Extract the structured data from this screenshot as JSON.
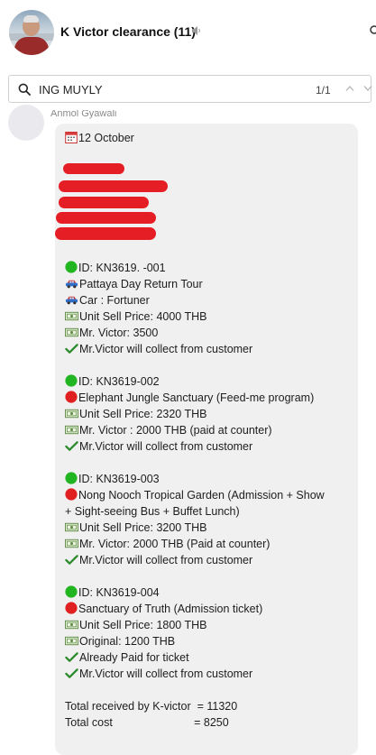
{
  "header": {
    "chat_title": "K Victor clearance (11)"
  },
  "search": {
    "query": "ING MUYLY",
    "match_count": "1/1"
  },
  "message": {
    "sender_name": "Anmol Gyawali",
    "date_line": "12 October",
    "bookings": [
      {
        "id_line": "ID: KN3619. -001",
        "tour_line": "Pattaya Day Return Tour",
        "car_line": "Car : Fortuner",
        "sell_price_line": "Unit Sell Price: 4000 THB",
        "cost_line": "Mr. Victor: 3500",
        "collect_line": "Mr.Victor will collect from customer"
      },
      {
        "id_line": "ID: KN3619-002",
        "tour_line": "Elephant Jungle Sanctuary (Feed-me program)",
        "sell_price_line": "Unit Sell Price: 2320 THB",
        "cost_line": "Mr. Victor : 2000 THB (paid at counter)",
        "collect_line": "Mr.Victor will collect from customer"
      },
      {
        "id_line": "ID: KN3619-003",
        "tour_line_1": "Nong Nooch Tropical Garden (Admission + Show",
        "tour_line_2": "+ Sight-seeing Bus + Buffet Lunch)",
        "sell_price_line": "Unit Sell Price: 3200 THB",
        "cost_line": "Mr. Victor: 2000 THB (Paid at counter)",
        "collect_line": "Mr.Victor will collect from customer"
      },
      {
        "id_line": "ID: KN3619-004",
        "tour_line": "Sanctuary of Truth (Admission ticket)",
        "sell_price_line": "Unit Sell Price: 1800 THB",
        "cost_line": "Original: 1200 THB",
        "paid_line": "Already Paid for ticket",
        "collect_line": "Mr.Victor will collect from customer"
      }
    ],
    "total_received": "Total received by K-victor  = 11320",
    "total_cost": "Total cost                          = 8250"
  },
  "colors": {
    "status_green": "#21b521",
    "status_red": "#e02020",
    "redaction": "#e51d24",
    "checkmark": "#2b8a2b",
    "bubble_bg": "#f0f0f0"
  },
  "icons": {
    "date": "calendar-icon",
    "car": "car-icon",
    "money": "banknote-icon",
    "done": "checkmark-icon",
    "ok_status": "green-circle-icon",
    "alert_status": "red-circle-icon"
  }
}
